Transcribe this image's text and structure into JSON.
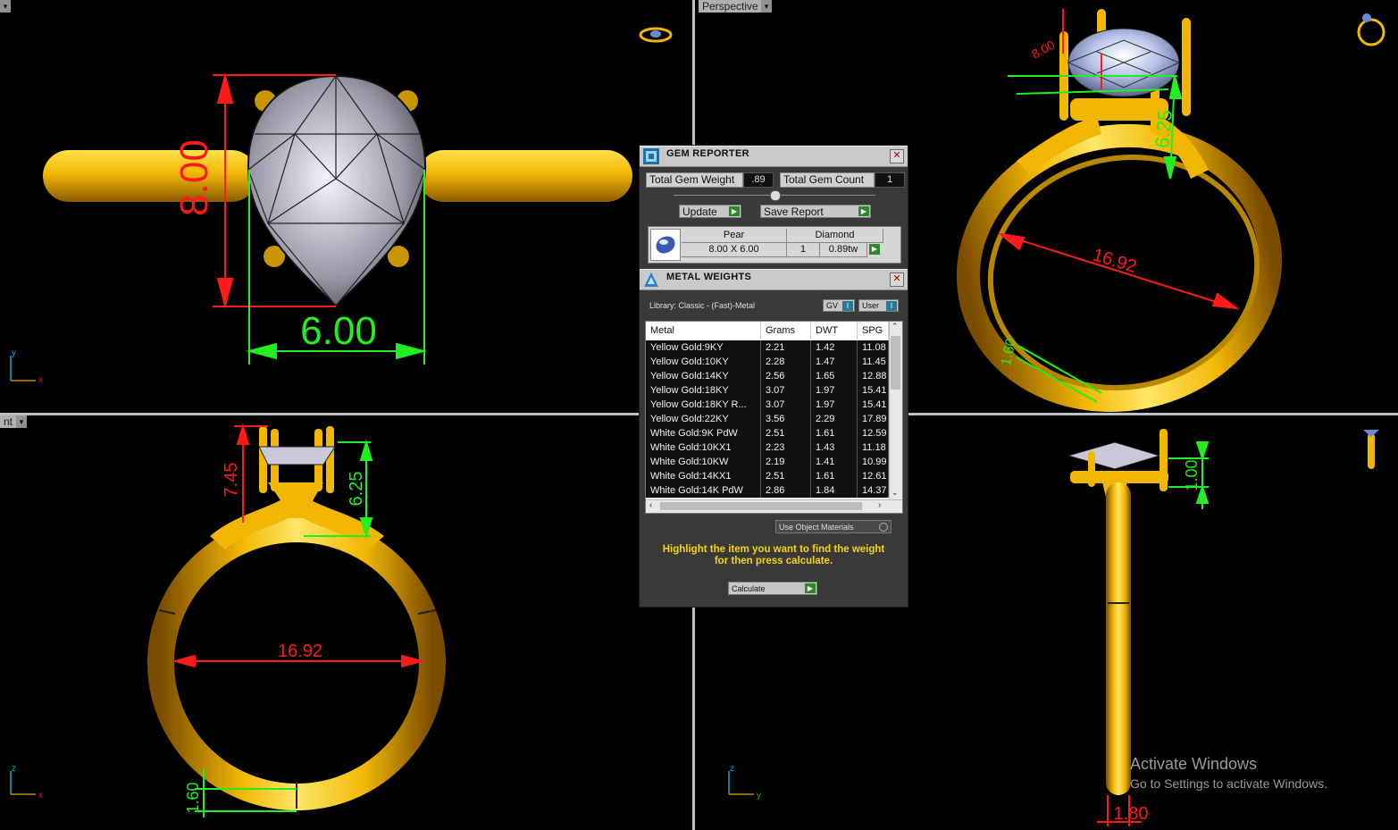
{
  "viewports": {
    "top_left": {
      "label": ""
    },
    "top_right": {
      "label": "Perspective"
    },
    "bottom_left": {
      "label": "nt"
    },
    "bottom_right": {
      "label": ""
    }
  },
  "dimensions": {
    "tl_height": "8.00",
    "tl_width": "6.00",
    "tr_size": "16.92",
    "tr_prong": "6.25",
    "tr_shank": "1.60",
    "tr_top": "8.00",
    "bl_overall": "7.45",
    "bl_prong": "6.25",
    "bl_size": "16.92",
    "bl_shank": "1.60",
    "br_gap": "1.00",
    "br_width": "1.80"
  },
  "axes": {
    "tl": {
      "v": "y",
      "h": "x"
    },
    "bl": {
      "v": "z",
      "h": "x"
    },
    "br": {
      "v": "z",
      "h": "y"
    }
  },
  "gem_reporter": {
    "title": "GEM REPORTER",
    "total_weight_label": "Total Gem Weight",
    "total_weight_value": ".89",
    "total_count_label": "Total Gem Count",
    "total_count_value": "1",
    "update_label": "Update",
    "save_label": "Save Report",
    "gem": {
      "shape": "Pear",
      "type": "Diamond",
      "size": "8.00 X 6.00",
      "count": "1",
      "weight": "0.89tw"
    }
  },
  "metal_weights": {
    "title": "METAL WEIGHTS",
    "library": "Library: Classic - (Fast)-Metal",
    "gv_label": "GV",
    "user_label": "User",
    "columns": [
      "Metal",
      "Grams",
      "DWT",
      "SPG"
    ],
    "rows": [
      [
        "Yellow Gold:9KY",
        "2.21",
        "1.42",
        "11.08"
      ],
      [
        "Yellow Gold:10KY",
        "2.28",
        "1.47",
        "11.45"
      ],
      [
        "Yellow Gold:14KY",
        "2.56",
        "1.65",
        "12.88"
      ],
      [
        "Yellow Gold:18KY",
        "3.07",
        "1.97",
        "15.41"
      ],
      [
        "Yellow Gold:18KY R...",
        "3.07",
        "1.97",
        "15.41"
      ],
      [
        "Yellow Gold:22KY",
        "3.56",
        "2.29",
        "17.89"
      ],
      [
        "White Gold:9K PdW",
        "2.51",
        "1.61",
        "12.59"
      ],
      [
        "White Gold:10KX1",
        "2.23",
        "1.43",
        "11.18"
      ],
      [
        "White Gold:10KW",
        "2.19",
        "1.41",
        "10.99"
      ],
      [
        "White Gold:14KX1",
        "2.51",
        "1.61",
        "12.61"
      ],
      [
        "White Gold:14K PdW",
        "2.86",
        "1.84",
        "14.37"
      ]
    ],
    "use_object_materials": "Use Object Materials",
    "message_line1": "Highlight the item you want to find the weight",
    "message_line2": "for then press calculate.",
    "calculate_label": "Calculate"
  },
  "watermark": {
    "title": "Activate Windows",
    "subtitle": "Go to Settings to activate Windows."
  },
  "colors": {
    "gold": "#f2b705",
    "dim_red": "#ff1a1a",
    "dim_green": "#22ee22",
    "panel_bg": "#3a3a3a"
  }
}
